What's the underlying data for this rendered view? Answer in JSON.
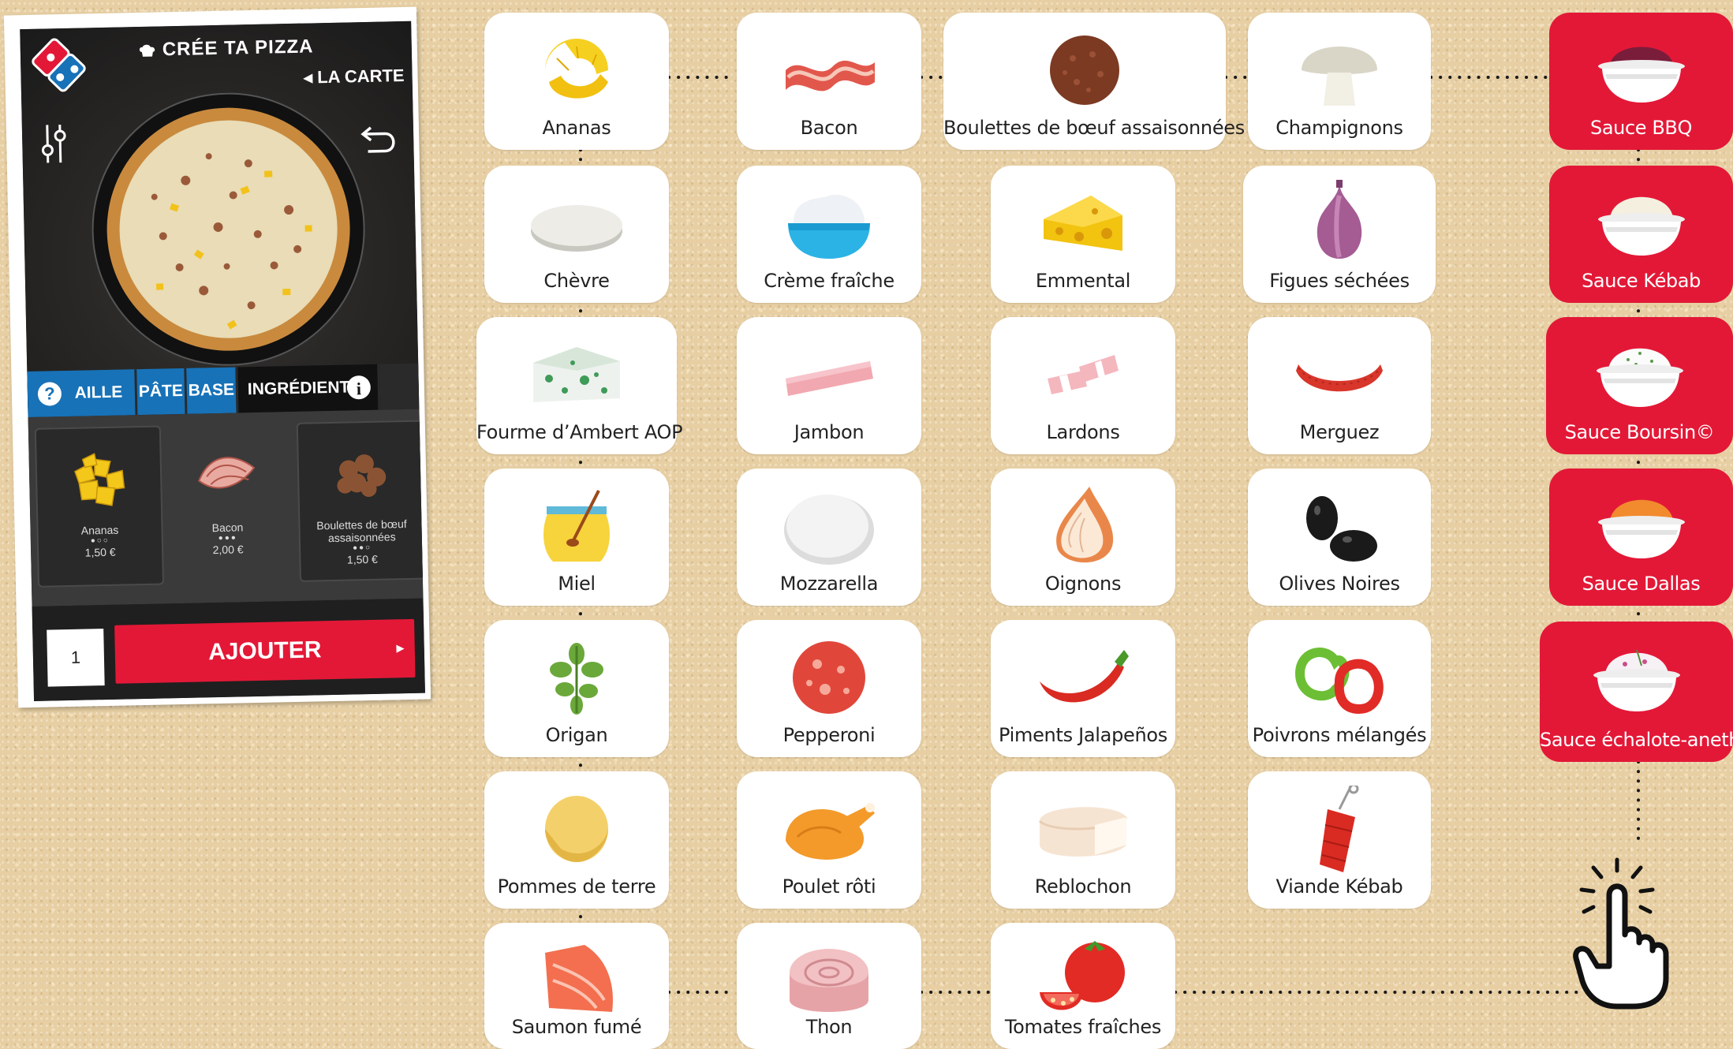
{
  "phone": {
    "title": "CRÉE TA PIZZA",
    "back_label": "◂ LA CARTE",
    "tabs": [
      "AILLE",
      "PÂTE",
      "BASE",
      "INGRÉDIENT"
    ],
    "cards": [
      {
        "name": "Ananas",
        "price": "1,50 €"
      },
      {
        "name": "Bacon",
        "price": "2,00 €"
      },
      {
        "name": "Boulettes de bœuf assaisonnées",
        "price": "1,50 €"
      }
    ],
    "quantity": "1",
    "add_label": "AJOUTER",
    "add_arrow": "▸"
  },
  "ingredients": [
    "Ananas",
    "Bacon",
    "Boulettes de bœuf assaisonnées",
    "Champignons",
    "Chèvre",
    "Crème fraîche",
    "Emmental",
    "Figues séchées",
    "Fourme d’Ambert AOP",
    "Jambon",
    "Lardons",
    "Merguez",
    "Miel",
    "Mozzarella",
    "Oignons",
    "Olives Noires",
    "Origan",
    "Pepperoni",
    "Piments Jalapeños",
    "Poivrons mélangés",
    "Pommes de terre",
    "Poulet rôti",
    "Reblochon",
    "Viande Kébab",
    "Saumon fumé",
    "Thon",
    "Tomates fraîches"
  ],
  "sauces": [
    "Sauce BBQ",
    "Sauce Kébab",
    "Sauce Boursin©",
    "Sauce Dallas",
    "Sauce échalote-aneth"
  ],
  "colors": {
    "brand_red": "#e31837",
    "brand_blue": "#1772b8",
    "phone_bg": "#1f1f1f"
  },
  "icons": {
    "sauce": "sauce-bowl-icon",
    "pointer": "hand-pointer-icon"
  }
}
